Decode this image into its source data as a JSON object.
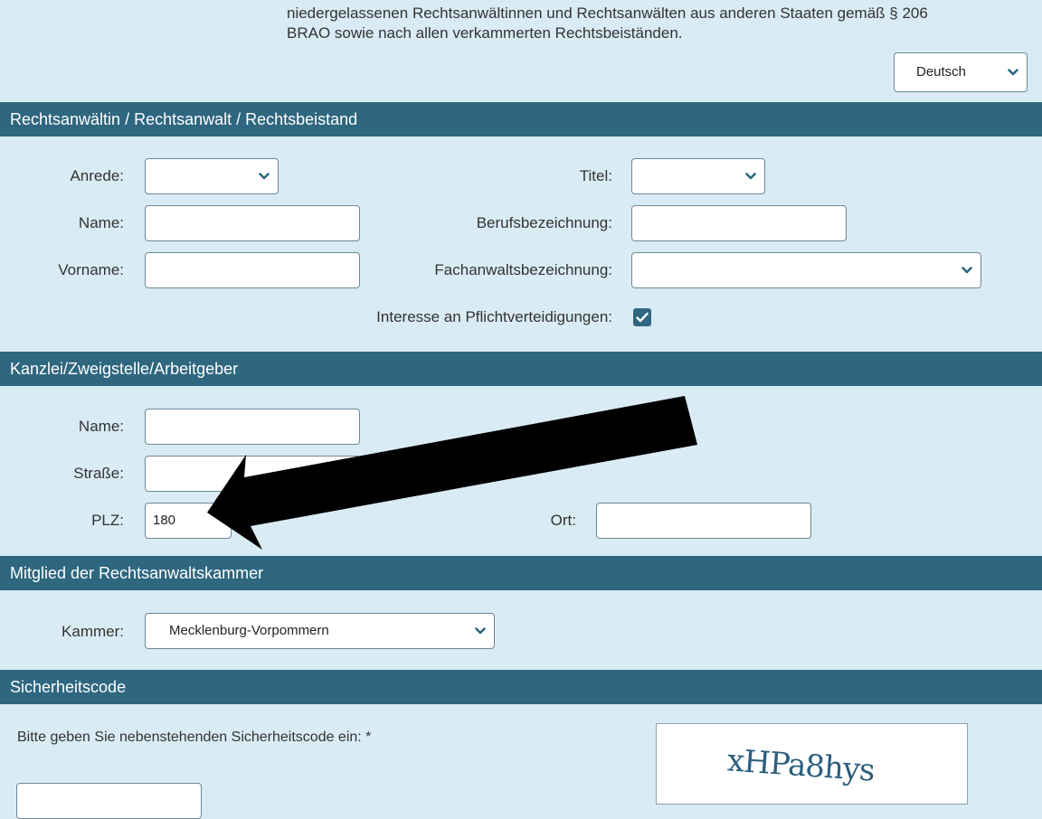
{
  "intro": {
    "line1": "niedergelassenen Rechtsanwältinnen und Rechtsanwälten aus anderen Staaten gemäß § 206",
    "line2": "BRAO sowie nach allen verkammerten Rechtsbeiständen."
  },
  "language": {
    "value": "Deutsch"
  },
  "section1": {
    "title": "Rechtsanwältin / Rechtsanwalt / Rechtsbeistand",
    "anrede_label": "Anrede:",
    "titel_label": "Titel:",
    "name_label": "Name:",
    "beruf_label": "Berufsbezeichnung:",
    "vorname_label": "Vorname:",
    "fachanwalt_label": "Fachanwaltsbezeichnung:",
    "pflicht_label": "Interesse an Pflichtverteidigungen:",
    "pflicht_checked": true
  },
  "section2": {
    "title": "Kanzlei/Zweigstelle/Arbeitgeber",
    "name_label": "Name:",
    "strasse_label": "Straße:",
    "plz_label": "PLZ:",
    "plz_value": "180",
    "ort_label": "Ort:"
  },
  "section3": {
    "title": "Mitglied der Rechtsanwaltskammer",
    "kammer_label": "Kammer:",
    "kammer_value": "Mecklenburg-Vorpommern"
  },
  "section4": {
    "title": "Sicherheitscode",
    "prompt": "Bitte geben Sie nebenstehenden Sicherheitscode ein: *",
    "captcha_text": "xHPa8hys"
  },
  "colors": {
    "background": "#d9ebf4",
    "section_bar": "#2e677f",
    "accent": "#2e677f"
  }
}
